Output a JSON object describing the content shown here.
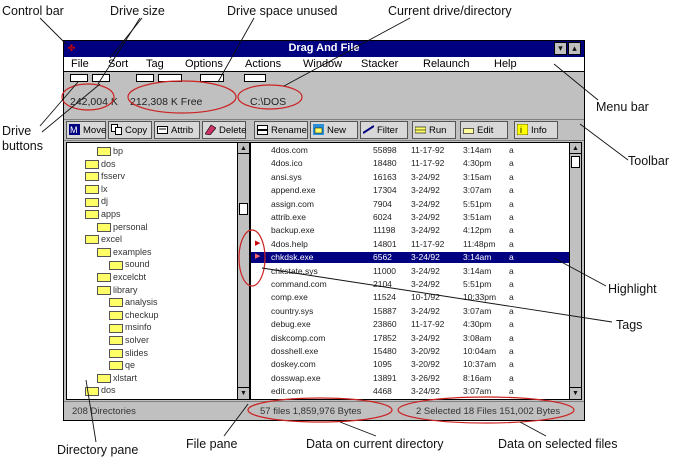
{
  "window": {
    "title": "Drag And File",
    "menu": [
      "File",
      "Sort",
      "Tag",
      "Options",
      "Actions",
      "Window",
      "Stacker",
      "Relaunch",
      "Help"
    ]
  },
  "info": {
    "drive_size": "242,004 K",
    "drive_free": "212,308 K Free",
    "current_dir": "C:\\DOS"
  },
  "toolbar": [
    "Move",
    "Copy",
    "Attrib",
    "Delete",
    "Rename",
    "New",
    "Filter",
    "Run",
    "Edit",
    "Info"
  ],
  "directories": [
    {
      "name": "bp",
      "indent": 2
    },
    {
      "name": "dos",
      "indent": 1
    },
    {
      "name": "fsserv",
      "indent": 1
    },
    {
      "name": "lx",
      "indent": 1
    },
    {
      "name": "dj",
      "indent": 1
    },
    {
      "name": "apps",
      "indent": 1
    },
    {
      "name": "personal",
      "indent": 2
    },
    {
      "name": "excel",
      "indent": 1
    },
    {
      "name": "examples",
      "indent": 2
    },
    {
      "name": "sound",
      "indent": 3
    },
    {
      "name": "excelcbt",
      "indent": 2
    },
    {
      "name": "library",
      "indent": 2
    },
    {
      "name": "analysis",
      "indent": 3
    },
    {
      "name": "checkup",
      "indent": 3
    },
    {
      "name": "msinfo",
      "indent": 3
    },
    {
      "name": "solver",
      "indent": 3
    },
    {
      "name": "slides",
      "indent": 3
    },
    {
      "name": "qe",
      "indent": 3
    },
    {
      "name": "xlstart",
      "indent": 2
    },
    {
      "name": "dos",
      "indent": 1
    }
  ],
  "files": [
    {
      "name": "4dos.com",
      "size": "55898",
      "date": "11-17-92",
      "time": "3:14am",
      "attr": "a",
      "tag": false,
      "sel": false
    },
    {
      "name": "4dos.ico",
      "size": "18480",
      "date": "11-17-92",
      "time": "4:30pm",
      "attr": "a",
      "tag": false,
      "sel": false
    },
    {
      "name": "ansi.sys",
      "size": "16163",
      "date": "3-24/92",
      "time": "3:15am",
      "attr": "a",
      "tag": false,
      "sel": false
    },
    {
      "name": "append.exe",
      "size": "17304",
      "date": "3-24/92",
      "time": "3:07am",
      "attr": "a",
      "tag": false,
      "sel": false
    },
    {
      "name": "assign.com",
      "size": "7904",
      "date": "3-24/92",
      "time": "5:51pm",
      "attr": "a",
      "tag": false,
      "sel": false
    },
    {
      "name": "attrib.exe",
      "size": "6024",
      "date": "3-24/92",
      "time": "3:51am",
      "attr": "a",
      "tag": false,
      "sel": false
    },
    {
      "name": "backup.exe",
      "size": "11198",
      "date": "3-24/92",
      "time": "4:12pm",
      "attr": "a",
      "tag": false,
      "sel": false
    },
    {
      "name": "4dos.help",
      "size": "14801",
      "date": "11-17-92",
      "time": "11:48pm",
      "attr": "a",
      "tag": true,
      "sel": false
    },
    {
      "name": "chkdsk.exe",
      "size": "6562",
      "date": "3-24/92",
      "time": "3:14am",
      "attr": "a",
      "tag": true,
      "sel": true
    },
    {
      "name": "chkstate.sys",
      "size": "11000",
      "date": "3-24/92",
      "time": "3:14am",
      "attr": "a",
      "tag": false,
      "sel": false
    },
    {
      "name": "command.com",
      "size": "2104",
      "date": "3-24/92",
      "time": "5:51pm",
      "attr": "a",
      "tag": false,
      "sel": false
    },
    {
      "name": "comp.exe",
      "size": "11524",
      "date": "10-1/92",
      "time": "10:33pm",
      "attr": "a",
      "tag": false,
      "sel": false
    },
    {
      "name": "country.sys",
      "size": "15887",
      "date": "3-24/92",
      "time": "3:07am",
      "attr": "a",
      "tag": false,
      "sel": false
    },
    {
      "name": "debug.exe",
      "size": "23860",
      "date": "11-17-92",
      "time": "4:30pm",
      "attr": "a",
      "tag": false,
      "sel": false
    },
    {
      "name": "diskcomp.com",
      "size": "17852",
      "date": "3-24/92",
      "time": "3:08am",
      "attr": "a",
      "tag": false,
      "sel": false
    },
    {
      "name": "dosshell.exe",
      "size": "15480",
      "date": "3-20/92",
      "time": "10:04am",
      "attr": "a",
      "tag": false,
      "sel": false
    },
    {
      "name": "doskey.com",
      "size": "1095",
      "date": "3-20/92",
      "time": "10:37am",
      "attr": "a",
      "tag": false,
      "sel": false
    },
    {
      "name": "dosswap.exe",
      "size": "13891",
      "date": "3-26/92",
      "time": "8:16am",
      "attr": "a",
      "tag": false,
      "sel": false
    },
    {
      "name": "edit.com",
      "size": "4468",
      "date": "3-24/92",
      "time": "3:07am",
      "attr": "a",
      "tag": false,
      "sel": false
    }
  ],
  "status": {
    "directories": "208 Directories",
    "current": "57 files 1,859,976 Bytes",
    "selected": "2 Selected 18 Files 151,002 Bytes"
  },
  "callouts": {
    "control_bar": "Control bar",
    "drive_size": "Drive size",
    "drive_space_unused": "Drive space unused",
    "current_drive_directory": "Current drive/directory",
    "menu_bar": "Menu bar",
    "drive_buttons": "Drive\nbuttons",
    "toolbar": "Toolbar",
    "highlight": "Highlight",
    "tags": "Tags",
    "directory_pane": "Directory pane",
    "file_pane": "File pane",
    "data_current_directory": "Data on current directory",
    "data_selected_files": "Data on selected files"
  },
  "colors": {
    "title_bar": "#000080",
    "selection": "#000080",
    "tag_marker": "#cc0000",
    "annotation_ellipse": "#cc2222"
  }
}
